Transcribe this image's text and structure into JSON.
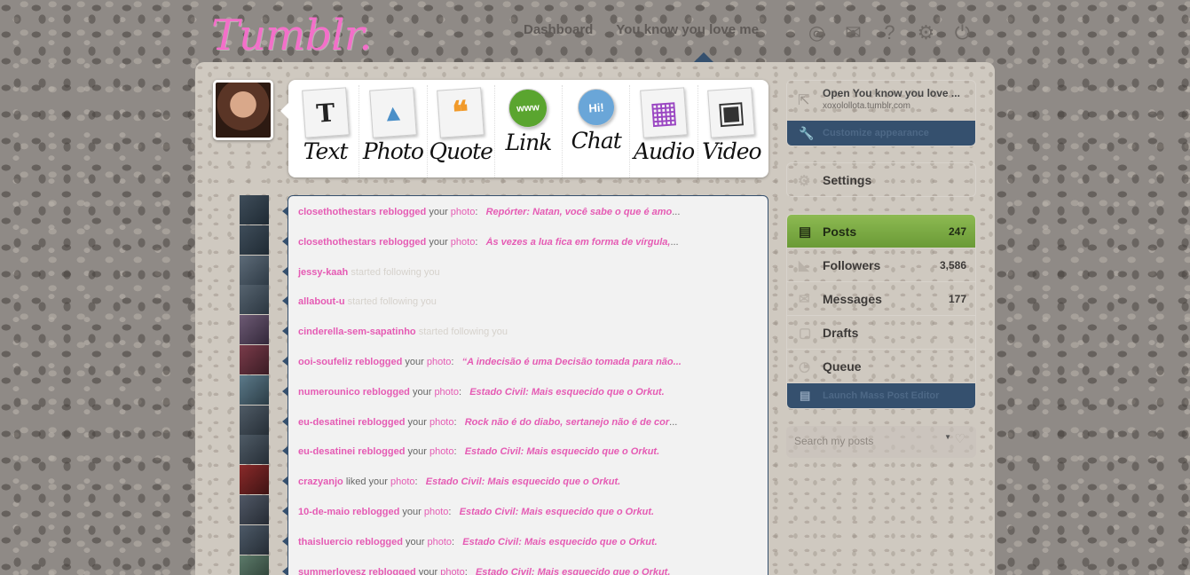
{
  "header": {
    "logo": "Tumblr.",
    "nav": [
      "Dashboard",
      "You know you love me"
    ],
    "icons": [
      "compass-icon",
      "mail-icon",
      "help-icon",
      "gear-icon",
      "power-icon"
    ]
  },
  "post_types": [
    "Text",
    "Photo",
    "Quote",
    "Link",
    "Chat",
    "Audio",
    "Video"
  ],
  "post_type_icons": {
    "Text": "T",
    "Photo": "▲",
    "Quote": "❝",
    "Link": "www",
    "Chat": "Hi!",
    "Audio": "▦",
    "Video": "▣"
  },
  "feed": [
    {
      "user": "closethothestars",
      "action": "reblogged",
      "your": "your",
      "item": "photo",
      "quote": "Repórter: Natan, você sabe o que é amo",
      "ellipsis": "..."
    },
    {
      "user": "closethothestars",
      "action": "reblogged",
      "your": "your",
      "item": "photo",
      "quote": "Às vezes a lua fica em forma de vírgula,",
      "ellipsis": "..."
    },
    {
      "user": "jessy-kaah",
      "action": "started following you",
      "your": "",
      "item": "",
      "quote": "",
      "ellipsis": ""
    },
    {
      "user": "allabout-u",
      "action": "started following you",
      "your": "",
      "item": "",
      "quote": "",
      "ellipsis": ""
    },
    {
      "user": "cinderella-sem-sapatinho",
      "action": "started following you",
      "your": "",
      "item": "",
      "quote": "",
      "ellipsis": ""
    },
    {
      "user": "ooi-soufeliz",
      "action": "reblogged",
      "your": "your",
      "item": "photo",
      "quote": "“A indecisão é uma Decisão tomada para não...",
      "ellipsis": ""
    },
    {
      "user": "numerounico",
      "action": "reblogged",
      "your": "your",
      "item": "photo",
      "quote": "Estado Civil:  Mais esquecido que o Orkut.",
      "ellipsis": ""
    },
    {
      "user": "eu-desatinei",
      "action": "reblogged",
      "your": "your",
      "item": "photo",
      "quote": "Rock não é do diabo, sertanejo não é de cor",
      "ellipsis": "..."
    },
    {
      "user": "eu-desatinei",
      "action": "reblogged",
      "your": "your",
      "item": "photo",
      "quote": "Estado Civil:  Mais esquecido que o Orkut.",
      "ellipsis": ""
    },
    {
      "user": "crazyanjo",
      "action": "liked",
      "your": "your",
      "item": "photo",
      "quote": "Estado Civil:  Mais esquecido que o Orkut.",
      "ellipsis": ""
    },
    {
      "user": "10-de-maio",
      "action": "reblogged",
      "your": "your",
      "item": "photo",
      "quote": "Estado Civil:  Mais esquecido que o Orkut.",
      "ellipsis": ""
    },
    {
      "user": "thaisluercio",
      "action": "reblogged",
      "your": "your",
      "item": "photo",
      "quote": "Estado Civil:  Mais esquecido que o Orkut.",
      "ellipsis": ""
    },
    {
      "user": "summerlovesz",
      "action": "reblogged",
      "your": "your",
      "item": "photo",
      "quote": "Estado Civil:  Mais esquecido que o Orkut.",
      "ellipsis": ""
    }
  ],
  "sidebar": {
    "blog_title": "Open You know you love ...",
    "blog_url": "xoxolollota.tumblr.com",
    "customize": "Customize appearance",
    "settings": "Settings",
    "menu": [
      {
        "label": "Posts",
        "count": "247",
        "icon": "page-icon"
      },
      {
        "label": "Followers",
        "count": "3,586",
        "icon": "chart-icon"
      },
      {
        "label": "Messages",
        "count": "177",
        "icon": "envelope-icon"
      },
      {
        "label": "Drafts",
        "count": "",
        "icon": "draft-icon"
      },
      {
        "label": "Queue",
        "count": "",
        "icon": "clock-icon"
      }
    ],
    "mass_editor": "Launch Mass Post Editor",
    "search_placeholder": "Search my posts"
  }
}
